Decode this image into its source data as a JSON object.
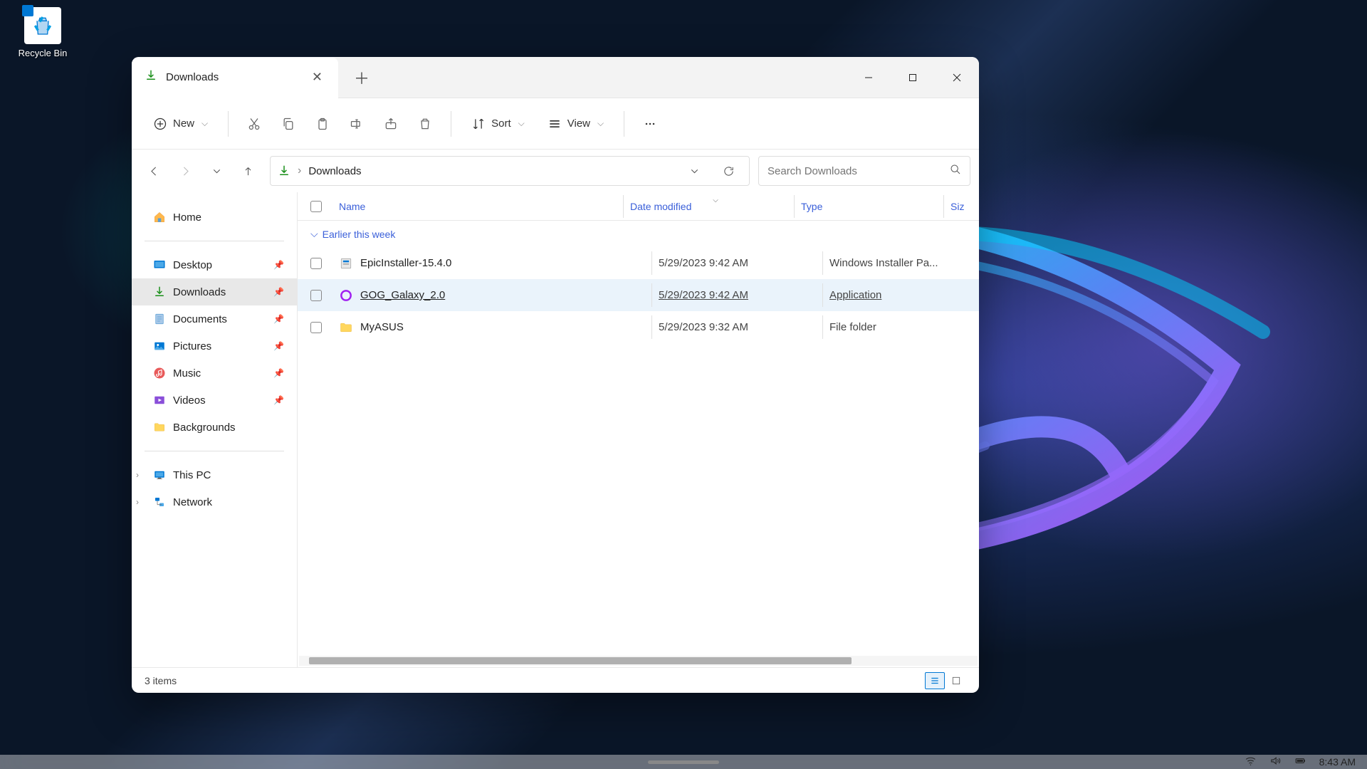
{
  "desktop": {
    "recycle_bin": "Recycle Bin"
  },
  "window": {
    "tab_title": "Downloads",
    "toolbar": {
      "new": "New",
      "sort": "Sort",
      "view": "View"
    },
    "address": {
      "location": "Downloads"
    },
    "search": {
      "placeholder": "Search Downloads"
    },
    "sidebar": {
      "home": "Home",
      "desktop": "Desktop",
      "downloads": "Downloads",
      "documents": "Documents",
      "pictures": "Pictures",
      "music": "Music",
      "videos": "Videos",
      "backgrounds": "Backgrounds",
      "this_pc": "This PC",
      "network": "Network"
    },
    "columns": {
      "name": "Name",
      "date": "Date modified",
      "type": "Type",
      "size": "Siz"
    },
    "group": "Earlier this week",
    "files": [
      {
        "name": "EpicInstaller-15.4.0",
        "date": "5/29/2023 9:42 AM",
        "type": "Windows Installer Pa..."
      },
      {
        "name": "GOG_Galaxy_2.0",
        "date": "5/29/2023 9:42 AM",
        "type": "Application"
      },
      {
        "name": "MyASUS",
        "date": "5/29/2023 9:32 AM",
        "type": "File folder"
      }
    ],
    "status": "3 items"
  },
  "tray": {
    "time": "8:43 AM"
  }
}
